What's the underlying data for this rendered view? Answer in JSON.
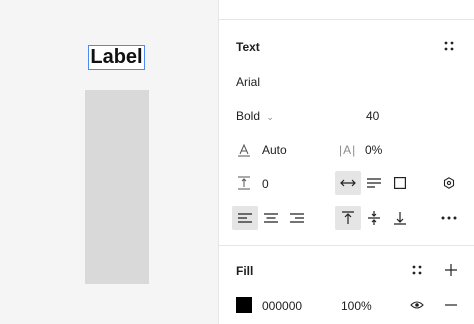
{
  "canvas": {
    "text_layer_label": "Label"
  },
  "text_section": {
    "title": "Text",
    "font_family": "Arial",
    "font_weight": "Bold",
    "font_size": "40",
    "line_height_value": "Auto",
    "letter_spacing_value": "0%",
    "paragraph_spacing_value": "0"
  },
  "fill_section": {
    "title": "Fill",
    "hex": "000000",
    "opacity": "100%",
    "swatch_color": "#000000"
  }
}
